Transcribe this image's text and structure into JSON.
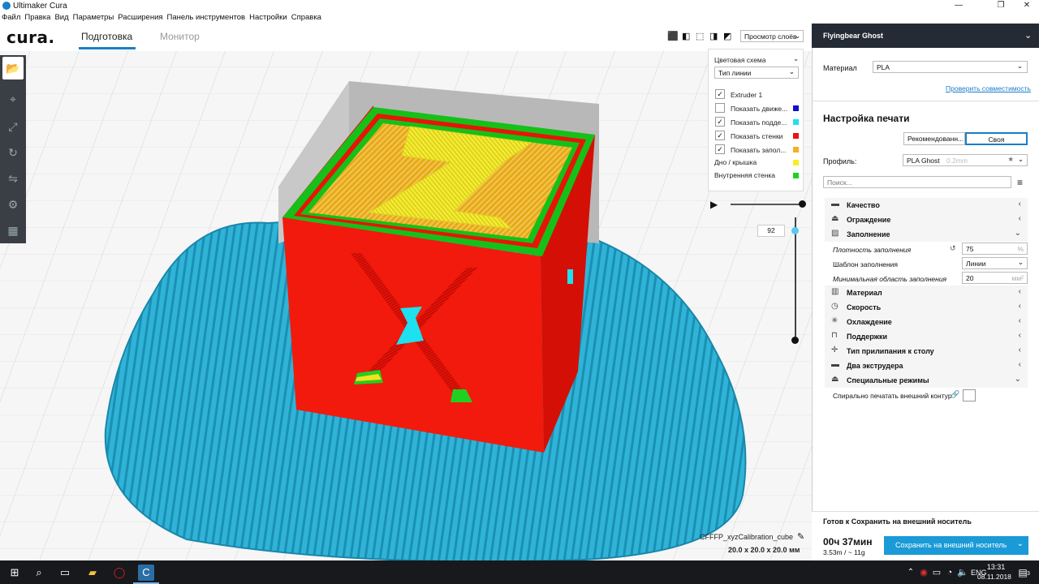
{
  "window": {
    "title": "Ultimaker Cura",
    "controls": [
      "—",
      "❐",
      "✕"
    ]
  },
  "menu": [
    "Файл",
    "Правка",
    "Вид",
    "Параметры",
    "Расширения",
    "Панель инструментов",
    "Настройки",
    "Справка"
  ],
  "app": {
    "logo": "cura.",
    "tabs": [
      {
        "label": "Подготовка",
        "active": true
      },
      {
        "label": "Монитор",
        "active": false
      }
    ],
    "view_mode": "Просмотр слоёв"
  },
  "layer_view": {
    "color_scheme_label": "Цветовая схема",
    "color_scheme_value": "Тип линии",
    "items": [
      {
        "label": "Extruder 1",
        "checked": true,
        "color": ""
      },
      {
        "label": "Показать движе...",
        "checked": false,
        "color": "#1010d0"
      },
      {
        "label": "Показать подде...",
        "checked": true,
        "color": "#1ee0ee"
      },
      {
        "label": "Показать стенки",
        "checked": true,
        "color": "#f01010"
      },
      {
        "label": "Показать запол...",
        "checked": true,
        "color": "#f5b020"
      }
    ],
    "legend": [
      {
        "label": "Дно / крышка",
        "color": "#f5f020"
      },
      {
        "label": "Внутренняя стенка",
        "color": "#20d020"
      }
    ],
    "layer_number": "92"
  },
  "object": {
    "name": "CFFFP_xyzCalibration_cube",
    "dimensions": "20.0 x 20.0 x 20.0 мм"
  },
  "printer": {
    "name": "Flyingbear Ghost",
    "material_label": "Материал",
    "material_value": "PLA",
    "compat_link": "Проверить совместимость"
  },
  "print_setup": {
    "title": "Настройка печати",
    "mode_recommended": "Рекомендованн...",
    "mode_custom": "Своя",
    "profile_label": "Профиль:",
    "profile_value": "PLA Ghost",
    "profile_hint": "0.2mm",
    "search_placeholder": "Поиск...",
    "categories": [
      {
        "label": "Качество",
        "icon": "quality-icon",
        "glyph": "▬",
        "expanded": false
      },
      {
        "label": "Ограждение",
        "icon": "shell-icon",
        "glyph": "⏏",
        "expanded": false
      },
      {
        "label": "Заполнение",
        "icon": "infill-icon",
        "glyph": "▨",
        "expanded": true
      }
    ],
    "infill_settings": [
      {
        "label": "Плотность заполнения",
        "value": "75",
        "unit": "%"
      },
      {
        "label": "Шаблон заполнения",
        "value": "Линии",
        "unit": ""
      },
      {
        "label": "Минимальная область заполнения",
        "value": "20",
        "unit": "мм²"
      }
    ],
    "categories_after": [
      {
        "label": "Материал",
        "icon": "material-icon",
        "glyph": "▥"
      },
      {
        "label": "Скорость",
        "icon": "speed-icon",
        "glyph": "◷"
      },
      {
        "label": "Охлаждение",
        "icon": "cooling-icon",
        "glyph": "✳"
      },
      {
        "label": "Поддержки",
        "icon": "support-icon",
        "glyph": "⊓"
      },
      {
        "label": "Тип прилипания к столу",
        "icon": "adhesion-icon",
        "glyph": "✛"
      },
      {
        "label": "Два экструдера",
        "icon": "dual-extruder-icon",
        "glyph": "▬"
      },
      {
        "label": "Специальные режимы",
        "icon": "special-modes-icon",
        "glyph": "⏏"
      }
    ],
    "spiralize_label": "Спирально печатать внешний контур"
  },
  "output": {
    "ready_text": "Готов к Сохранить на внешний носитель",
    "time": "00ч 37мин",
    "material_usage": "3.53m / ~ 11g",
    "save_button": "Сохранить на внешний носитель"
  },
  "taskbar": {
    "lang": "ENG",
    "time": "13:31",
    "date": "08.11.2018",
    "notify_count": "3"
  }
}
